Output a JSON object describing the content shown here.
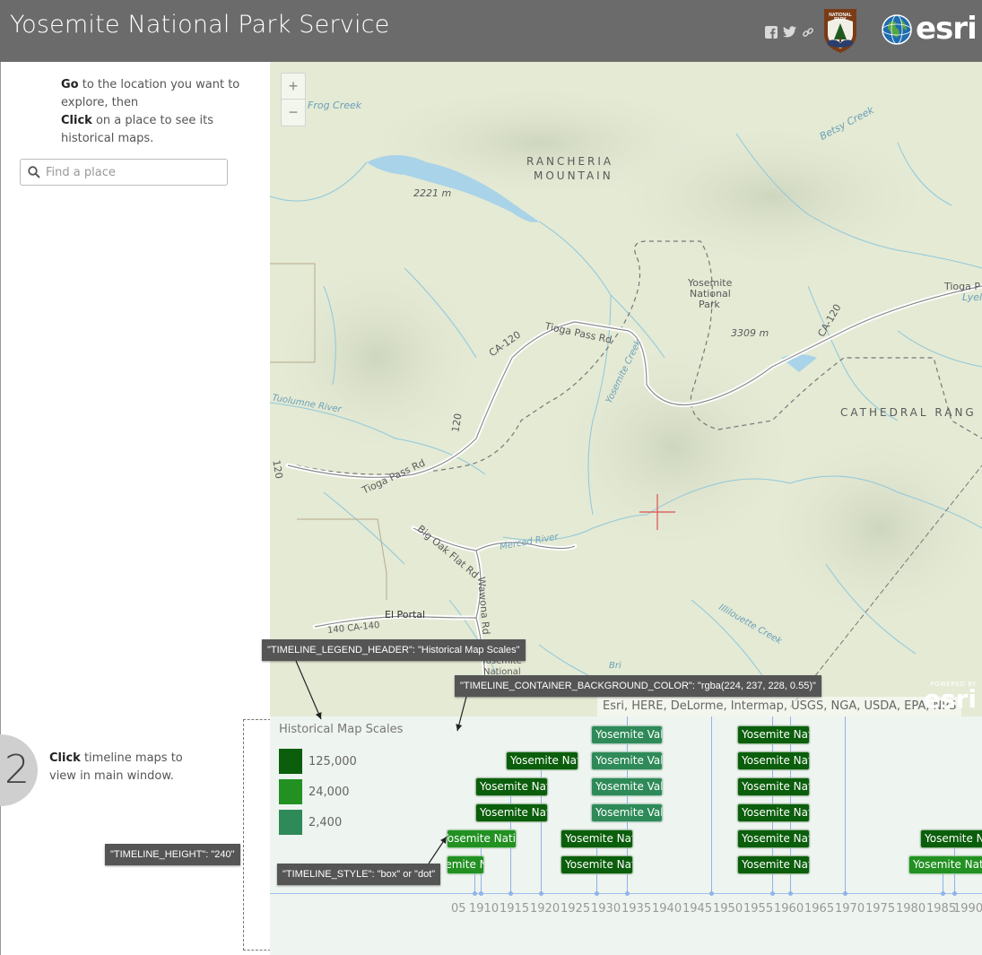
{
  "header": {
    "title": "Yosemite National Park Service",
    "social": {
      "facebook": "f",
      "twitter": "t",
      "link": "🔗"
    },
    "esri_word": "esri"
  },
  "sidebar": {
    "instructions": {
      "go": "Go",
      "line1": " to the location you want to explore, then",
      "click": "Click",
      "line2": " on a place to see its historical maps."
    },
    "search": {
      "placeholder": "Find a place"
    }
  },
  "map": {
    "zoom_in": "+",
    "zoom_out": "−",
    "labels": {
      "frog_creek": "Frog Creek",
      "rancheria": "RANCHERIA",
      "mountain": "MOUNTAIN",
      "elev_2221": "2221 m",
      "betsy_creek": "Betsy Creek",
      "yosemite_np_1": "Yosemite",
      "yosemite_np_2": "National",
      "yosemite_np_3": "Park",
      "tioga_right": "Tioga P",
      "lyell": "Lyel",
      "ca120_right": "CA-120",
      "elev_3309": "3309 m",
      "tioga_pass_rd": "Tioga Pass Rd",
      "ca120_mid": "CA-120",
      "yosemite_creek": "Yosemite Creek",
      "tuolumne": "Tuolumne River",
      "cathedral": "CATHEDRAL RANG",
      "r120": "120",
      "tioga_pass_rd2": "Tioga Pass Rd",
      "r120b": "120",
      "big_oak_flat": "Big Oak Flat Rd",
      "merced": "Merced River",
      "wawona": "Wawona Rd",
      "el_portal": "El Portal",
      "ca140": "140 CA-140",
      "illilouette": "Illilouette Creek",
      "yosemite_np_b1": "Yosemite",
      "yosemite_np_b2": "National",
      "bri": "Bri"
    },
    "attribution": "Esri, HERE, DeLorme, Intermap, USGS, NGA, USDA, EPA, NPS",
    "powered_by": "POWERED BY",
    "powered_esri": "esri"
  },
  "step2": {
    "number": "2",
    "click": "Click",
    "text": " timeline maps to view in main window."
  },
  "timeline": {
    "legend_header": "Historical Map Scales",
    "legend": [
      {
        "label": "125,000",
        "color": "#0b5e0b"
      },
      {
        "label": "24,000",
        "color": "#229122"
      },
      {
        "label": "2,400",
        "color": "#2e8a58"
      }
    ],
    "item_label": "Yosemite National Park",
    "item_label_valley": "Yosemite Valley",
    "ticks": [
      "05",
      "1910",
      "1915",
      "1920",
      "1925",
      "1930",
      "1935",
      "1940",
      "1945",
      "1950",
      "1955",
      "1960",
      "1965",
      "1970",
      "1975",
      "1980",
      "1985",
      "1990"
    ]
  },
  "callouts": {
    "legend_header": "\"TIMELINE_LEGEND_HEADER\": \"Historical Map Scales\"",
    "container_bg": "\"TIMELINE_CONTAINER_BACKGROUND_COLOR\": \"rgba(224, 237, 228, 0.55)\"",
    "height": "\"TIMELINE_HEIGHT\": \"240\"",
    "style": "\"TIMELINE_STYLE\": \"box\" or \"dot\""
  }
}
